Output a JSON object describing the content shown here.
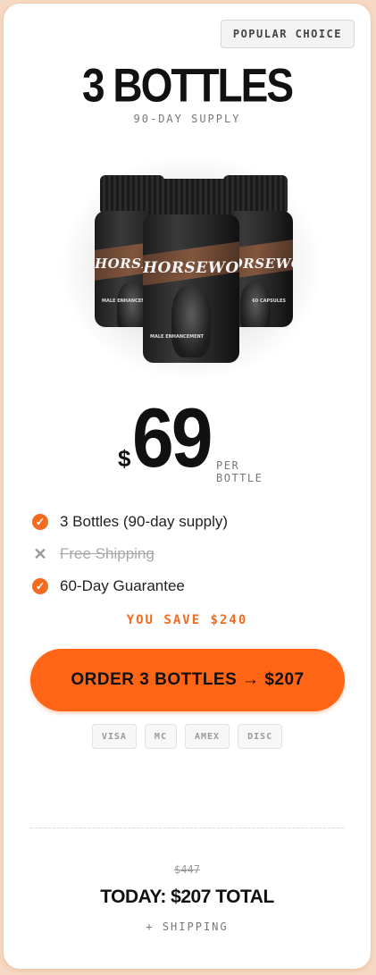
{
  "badge": "POPULAR CHOICE",
  "title": "3 BOTTLES",
  "supply": "90-DAY SUPPLY",
  "product": {
    "brand": "HORSEWOOD",
    "label_small": "MALE ENHANCEMENT",
    "label_caps": "60 CAPSULES",
    "image_icon": "supplement-bottles-image"
  },
  "price": {
    "currency": "$",
    "amount": "69",
    "per": "PER BOTTLE"
  },
  "features": [
    {
      "label": "3 Bottles (90-day supply)",
      "included": true
    },
    {
      "label": "Free Shipping",
      "included": false
    },
    {
      "label": "60-Day Guarantee",
      "included": true
    }
  ],
  "savings": "YOU SAVE $240",
  "order_button": "ORDER 3 BOTTLES → $207",
  "payment_methods": [
    "VISA",
    "MC",
    "AMEX",
    "DISC"
  ],
  "summary": {
    "original_price": "$447",
    "today_total": "TODAY: $207 TOTAL",
    "shipping_note": "+ SHIPPING"
  },
  "colors": {
    "accent": "#ff6514",
    "check": "#f26b1f",
    "background": "#f6d9c4"
  }
}
